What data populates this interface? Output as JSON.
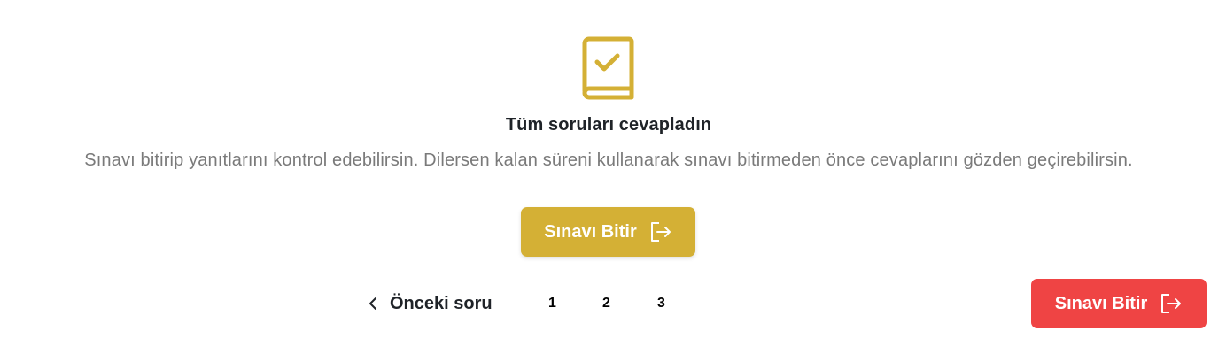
{
  "completion": {
    "icon": "book-check-icon",
    "title": "Tüm soruları cevapladın",
    "description": "Sınavı bitirip yanıtlarını kontrol edebilirsin. Dilersen kalan süreni kullanarak sınavı bitirmeden önce cevaplarını gözden geçirebilirsin.",
    "finish_button": "Sınavı Bitir"
  },
  "pagination": {
    "previous_label": "Önceki soru",
    "pages": [
      "1",
      "2",
      "3"
    ]
  },
  "footer": {
    "finish_button": "Sınavı Bitir"
  },
  "colors": {
    "accent": "#d4b035",
    "danger": "#ef4444",
    "text": "#1f2328",
    "muted": "#7a7a7a"
  }
}
